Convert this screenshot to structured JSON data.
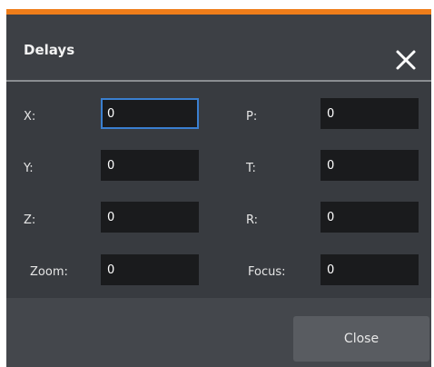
{
  "dialog": {
    "title": "Delays",
    "accent_color": "#ef7d1a",
    "close_icon": "close-icon"
  },
  "fields": [
    {
      "label": "X:",
      "value": "0"
    },
    {
      "label": "P:",
      "value": "0"
    },
    {
      "label": "Y:",
      "value": "0"
    },
    {
      "label": "T:",
      "value": "0"
    },
    {
      "label": "Z:",
      "value": "0"
    },
    {
      "label": "R:",
      "value": "0"
    },
    {
      "label": "Zoom:",
      "value": "0"
    },
    {
      "label": "Focus:",
      "value": "0"
    }
  ],
  "footer": {
    "close_label": "Close"
  }
}
